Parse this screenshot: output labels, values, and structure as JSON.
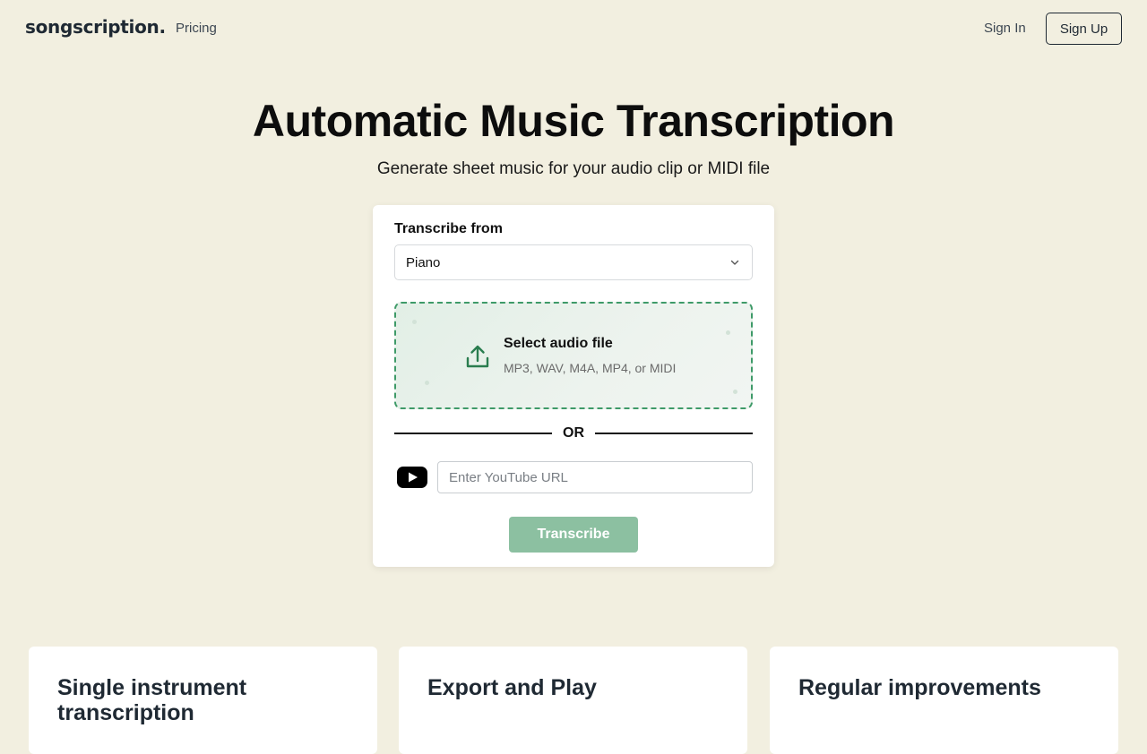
{
  "nav": {
    "logo": "songscription.",
    "links": [
      "Pricing"
    ],
    "sign_in": "Sign In",
    "sign_up": "Sign Up"
  },
  "hero": {
    "title": "Automatic Music Transcription",
    "subtitle": "Generate sheet music for your audio clip or MIDI file"
  },
  "form": {
    "label": "Transcribe from",
    "instrument": "Piano",
    "dropzone_title": "Select audio file",
    "dropzone_formats": "MP3, WAV, M4A, MP4, or MIDI",
    "or": "OR",
    "youtube_placeholder": "Enter YouTube URL",
    "submit": "Transcribe"
  },
  "features": [
    {
      "title": "Single instrument transcription"
    },
    {
      "title": "Export and Play"
    },
    {
      "title": "Regular improvements"
    }
  ],
  "colors": {
    "background": "#f2efe0",
    "accent": "#3e9a68",
    "button_disabled": "#8cc0a1"
  }
}
